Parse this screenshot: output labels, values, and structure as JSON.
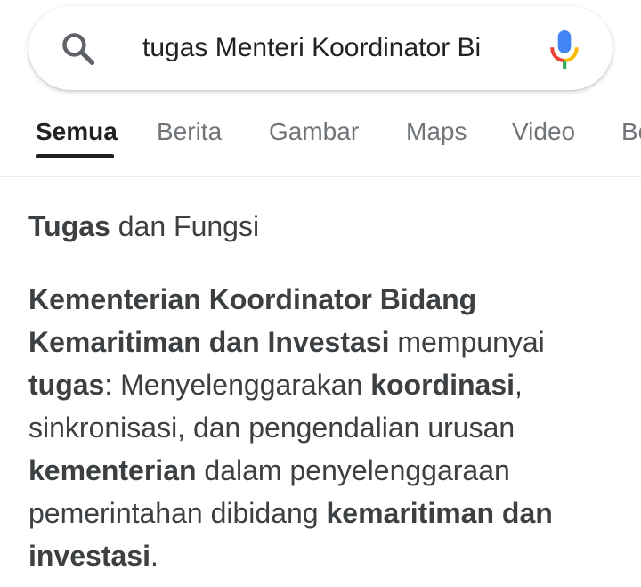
{
  "search": {
    "query": "tugas Menteri Koordinator Bi"
  },
  "tabs": [
    {
      "label": "Semua",
      "active": true
    },
    {
      "label": "Berita"
    },
    {
      "label": "Gambar"
    },
    {
      "label": "Maps"
    },
    {
      "label": "Video"
    },
    {
      "label": "Be"
    }
  ],
  "result": {
    "heading_bold": "Tugas",
    "heading_rest": " dan Fungsi",
    "snippet": [
      {
        "t": "Kementerian Koordinator Bidang Kemaritiman dan Investasi",
        "b": true
      },
      {
        "t": " mempunyai ",
        "b": false
      },
      {
        "t": "tugas",
        "b": true
      },
      {
        "t": ": Menyelenggarakan ",
        "b": false
      },
      {
        "t": "koordinasi",
        "b": true
      },
      {
        "t": ", sinkronisasi, dan pengendalian urusan ",
        "b": false
      },
      {
        "t": "kementerian",
        "b": true
      },
      {
        "t": " dalam penyelenggaraan pemerintahan dibidang ",
        "b": false
      },
      {
        "t": "kemaritiman dan investasi",
        "b": true
      },
      {
        "t": ".",
        "b": false
      }
    ]
  },
  "colors": {
    "text": "#3c4043",
    "tab_inactive": "#70757a",
    "mic_blue": "#4285f4",
    "mic_red": "#ea4335",
    "mic_yellow": "#fbbc04",
    "mic_green": "#34a853"
  },
  "icons": {
    "search": "search-icon",
    "mic": "mic-icon"
  }
}
